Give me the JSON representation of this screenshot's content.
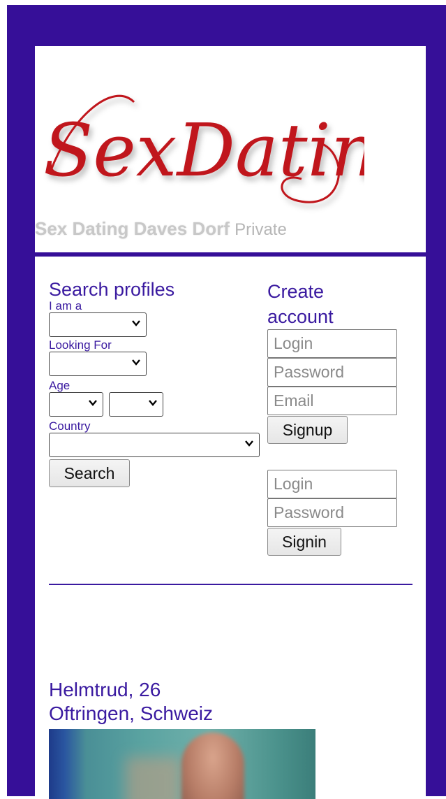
{
  "header": {
    "logo_text": "SexDating",
    "tagline_name": "Sex Dating Daves Dorf",
    "tagline_suffix": "Private"
  },
  "search": {
    "title": "Search profiles",
    "i_am_label": "I am a",
    "looking_for_label": "Looking For",
    "age_label": "Age",
    "country_label": "Country",
    "search_button": "Search"
  },
  "signup": {
    "title_line1": "Create",
    "title_line2": "account",
    "login_placeholder": "Login",
    "password_placeholder": "Password",
    "email_placeholder": "Email",
    "signup_button": "Signup"
  },
  "signin": {
    "login_placeholder": "Login",
    "password_placeholder": "Password",
    "signin_button": "Signin"
  },
  "profile": {
    "name_age": "Helmtrud, 26",
    "location": "Oftringen, Schweiz"
  },
  "colors": {
    "background": "#360f98",
    "accent_text": "#3a1aa0",
    "logo_red": "#c0141c"
  }
}
